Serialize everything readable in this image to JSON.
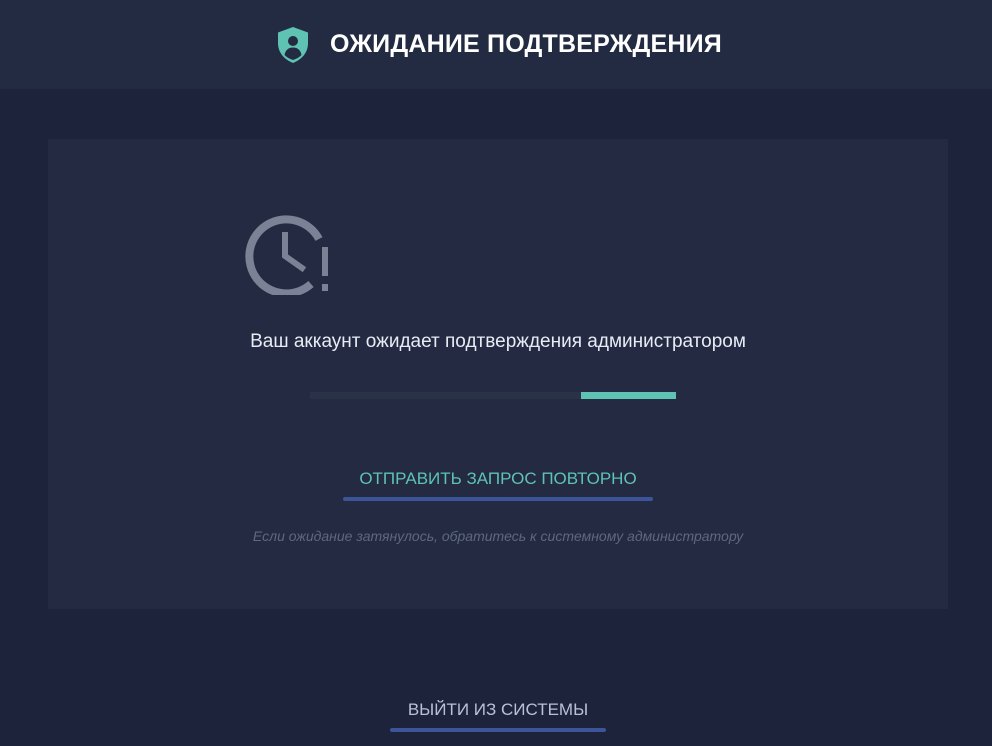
{
  "header": {
    "title": "ОЖИДАНИЕ ПОДТВЕРЖДЕНИЯ",
    "icon": "shield-user-icon",
    "icon_color": "#5ec3b3"
  },
  "status": {
    "icon": "clock-alert-icon",
    "message": "Ваш аккаунт ожидает подтверждения администратором"
  },
  "progress": {
    "fill_start_fraction": 0.74,
    "fill_end_fraction": 1.0,
    "color": "#5ec3b3"
  },
  "actions": {
    "resend_label": "ОТПРАВИТЬ ЗАПРОС ПОВТОРНО",
    "hint": "Если ожидание затянулось, обратитесь к системному администратору",
    "logout_label": "ВЫЙТИ ИЗ СИСТЕМЫ"
  },
  "colors": {
    "background": "#1c233a",
    "header_bg": "#232b42",
    "card_bg": "#232a41",
    "accent": "#5ec3b3",
    "underline": "#3b5598"
  }
}
